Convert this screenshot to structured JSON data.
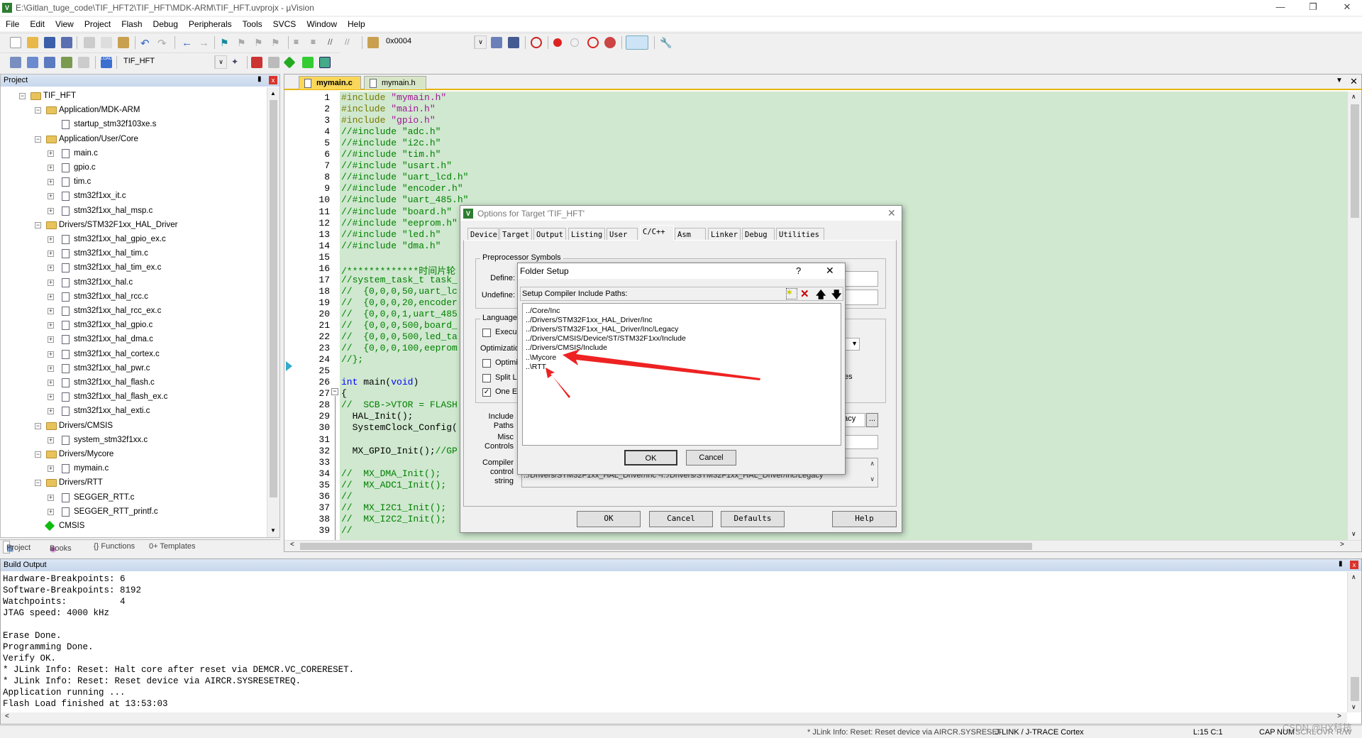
{
  "window": {
    "title": "E:\\Gitlan_tuge_code\\TIF_HFT2\\TIF_HFT\\MDK-ARM\\TIF_HFT.uvprojx - µVision",
    "app_icon": "uvision-icon"
  },
  "menu": [
    "File",
    "Edit",
    "View",
    "Project",
    "Flash",
    "Debug",
    "Peripherals",
    "Tools",
    "SVCS",
    "Window",
    "Help"
  ],
  "toolbar": {
    "address_value": "0x0004",
    "target_value": "TIF_HFT"
  },
  "project_panel": {
    "title": "Project",
    "tree": [
      {
        "label": "TIF_HFT",
        "level": 0,
        "type": "root",
        "expanded": true
      },
      {
        "label": "Application/MDK-ARM",
        "level": 1,
        "type": "folder",
        "expanded": true
      },
      {
        "label": "startup_stm32f103xe.s",
        "level": 2,
        "type": "file",
        "expandable": false
      },
      {
        "label": "Application/User/Core",
        "level": 1,
        "type": "folder",
        "expanded": true
      },
      {
        "label": "main.c",
        "level": 2,
        "type": "file",
        "expandable": true
      },
      {
        "label": "gpio.c",
        "level": 2,
        "type": "file",
        "expandable": true
      },
      {
        "label": "tim.c",
        "level": 2,
        "type": "file",
        "expandable": true
      },
      {
        "label": "stm32f1xx_it.c",
        "level": 2,
        "type": "file",
        "expandable": true
      },
      {
        "label": "stm32f1xx_hal_msp.c",
        "level": 2,
        "type": "file",
        "expandable": true
      },
      {
        "label": "Drivers/STM32F1xx_HAL_Driver",
        "level": 1,
        "type": "folder",
        "expanded": true
      },
      {
        "label": "stm32f1xx_hal_gpio_ex.c",
        "level": 2,
        "type": "file",
        "expandable": true
      },
      {
        "label": "stm32f1xx_hal_tim.c",
        "level": 2,
        "type": "file",
        "expandable": true
      },
      {
        "label": "stm32f1xx_hal_tim_ex.c",
        "level": 2,
        "type": "file",
        "expandable": true
      },
      {
        "label": "stm32f1xx_hal.c",
        "level": 2,
        "type": "file",
        "expandable": true
      },
      {
        "label": "stm32f1xx_hal_rcc.c",
        "level": 2,
        "type": "file",
        "expandable": true
      },
      {
        "label": "stm32f1xx_hal_rcc_ex.c",
        "level": 2,
        "type": "file",
        "expandable": true
      },
      {
        "label": "stm32f1xx_hal_gpio.c",
        "level": 2,
        "type": "file",
        "expandable": true
      },
      {
        "label": "stm32f1xx_hal_dma.c",
        "level": 2,
        "type": "file",
        "expandable": true
      },
      {
        "label": "stm32f1xx_hal_cortex.c",
        "level": 2,
        "type": "file",
        "expandable": true
      },
      {
        "label": "stm32f1xx_hal_pwr.c",
        "level": 2,
        "type": "file",
        "expandable": true
      },
      {
        "label": "stm32f1xx_hal_flash.c",
        "level": 2,
        "type": "file",
        "expandable": true
      },
      {
        "label": "stm32f1xx_hal_flash_ex.c",
        "level": 2,
        "type": "file",
        "expandable": true
      },
      {
        "label": "stm32f1xx_hal_exti.c",
        "level": 2,
        "type": "file",
        "expandable": true
      },
      {
        "label": "Drivers/CMSIS",
        "level": 1,
        "type": "folder",
        "expanded": true
      },
      {
        "label": "system_stm32f1xx.c",
        "level": 2,
        "type": "file",
        "expandable": true
      },
      {
        "label": "Drivers/Mycore",
        "level": 1,
        "type": "folder",
        "expanded": true
      },
      {
        "label": "mymain.c",
        "level": 2,
        "type": "file",
        "expandable": true
      },
      {
        "label": "Drivers/RTT",
        "level": 1,
        "type": "folder",
        "expanded": true
      },
      {
        "label": "SEGGER_RTT.c",
        "level": 2,
        "type": "file",
        "expandable": true
      },
      {
        "label": "SEGGER_RTT_printf.c",
        "level": 2,
        "type": "file",
        "expandable": true
      },
      {
        "label": "CMSIS",
        "level": 1,
        "type": "cmsis",
        "expanded": false
      }
    ],
    "tabs": [
      "Project",
      "Books",
      "{} Functions",
      "0+ Templates"
    ]
  },
  "editor": {
    "tabs": [
      {
        "label": "mymain.c",
        "active": true
      },
      {
        "label": "mymain.h",
        "active": false
      }
    ],
    "lines": [
      [
        [
          "pp",
          "#include "
        ],
        [
          "str",
          "\"mymain.h\""
        ]
      ],
      [
        [
          "pp",
          "#include "
        ],
        [
          "str",
          "\"main.h\""
        ]
      ],
      [
        [
          "pp",
          "#include "
        ],
        [
          "str",
          "\"gpio.h\""
        ]
      ],
      [
        [
          "cm",
          "//#include \"adc.h\""
        ]
      ],
      [
        [
          "cm",
          "//#include \"i2c.h\""
        ]
      ],
      [
        [
          "cm",
          "//#include \"tim.h\""
        ]
      ],
      [
        [
          "cm",
          "//#include \"usart.h\""
        ]
      ],
      [
        [
          "cm",
          "//#include \"uart_lcd.h\""
        ]
      ],
      [
        [
          "cm",
          "//#include \"encoder.h\""
        ]
      ],
      [
        [
          "cm",
          "//#include \"uart_485.h\""
        ]
      ],
      [
        [
          "cm",
          "//#include \"board.h\""
        ]
      ],
      [
        [
          "cm",
          "//#include \"eeprom.h\""
        ]
      ],
      [
        [
          "cm",
          "//#include \"led.h\""
        ]
      ],
      [
        [
          "cm",
          "//#include \"dma.h\""
        ]
      ],
      [],
      [
        [
          "cm",
          "/*************时间片轮"
        ]
      ],
      [
        [
          "cm",
          "//system_task_t task_"
        ]
      ],
      [
        [
          "cm",
          "//  {0,0,0,50,uart_lc"
        ]
      ],
      [
        [
          "cm",
          "//  {0,0,0,20,encoder"
        ]
      ],
      [
        [
          "cm",
          "//  {0,0,0,1,uart_485"
        ]
      ],
      [
        [
          "cm",
          "//  {0,0,0,500,board_"
        ]
      ],
      [
        [
          "cm",
          "//  {0,0,0,500,led_ta"
        ]
      ],
      [
        [
          "cm",
          "//  {0,0,0,100,eeprom"
        ]
      ],
      [
        [
          "cm",
          "//};"
        ]
      ],
      [],
      [
        [
          "kw",
          "int"
        ],
        [
          "nm",
          " main("
        ],
        [
          "kw",
          "void"
        ],
        [
          "nm",
          ")"
        ]
      ],
      [
        [
          "nm",
          "{"
        ]
      ],
      [
        [
          "cm",
          "//  SCB->VTOR = FLASH"
        ]
      ],
      [
        [
          "nm",
          "  HAL_Init();"
        ]
      ],
      [
        [
          "nm",
          "  SystemClock_Config("
        ]
      ],
      [],
      [
        [
          "nm",
          "  MX_GPIO_Init();"
        ],
        [
          "cm",
          "//GP"
        ]
      ],
      [],
      [
        [
          "cm",
          "//  MX_DMA_Init();"
        ]
      ],
      [
        [
          "cm",
          "//  MX_ADC1_Init();"
        ]
      ],
      [
        [
          "cm",
          "//"
        ]
      ],
      [
        [
          "cm",
          "//  MX_I2C1_Init();"
        ]
      ],
      [
        [
          "cm",
          "//  MX_I2C2_Init();"
        ]
      ],
      [
        [
          "cm",
          "//"
        ]
      ]
    ]
  },
  "build_output": {
    "title": "Build Output",
    "lines": [
      "Hardware-Breakpoints: 6",
      "Software-Breakpoints: 8192",
      "Watchpoints:          4",
      "JTAG speed: 4000 kHz",
      "",
      "Erase Done.",
      "Programming Done.",
      "Verify OK.",
      "* JLink Info: Reset: Halt core after reset via DEMCR.VC_CORERESET.",
      "* JLink Info: Reset: Reset device via AIRCR.SYSRESETREQ.",
      "Application running ...",
      "Flash Load finished at 13:53:03"
    ]
  },
  "status_bar": {
    "message": "* JLink Info: Reset: Reset device via AIRCR.SYSRESET",
    "debugger": "J-LINK / J-TRACE Cortex",
    "cursor": "L:15 C:1",
    "indicators": [
      "CAP",
      "NUM",
      "SCRL",
      "OVR",
      "R/W"
    ],
    "watermark": "CSDN @HX科技"
  },
  "options_dialog": {
    "title": "Options for Target 'TIF_HFT'",
    "tabs": [
      "Device",
      "Target",
      "Output",
      "Listing",
      "User",
      "C/C++",
      "Asm",
      "Linker",
      "Debug",
      "Utilities"
    ],
    "active_tab": "C/C++",
    "preprocessor_group": "Preprocessor Symbols",
    "define_label": "Define:",
    "undefine_label": "Undefine:",
    "language_group": "Language",
    "execute_only": {
      "label": "Execu",
      "checked": false
    },
    "optimization_label": "Optimizatio",
    "optimize_time": {
      "label": "Optimi",
      "checked": false
    },
    "split_ldm": {
      "label": "Split L",
      "checked": false
    },
    "one_elf": {
      "label": "One E",
      "checked": true
    },
    "partial_right_label": "es",
    "include_paths_label": "Include Paths",
    "include_paths_value": "gacy",
    "browse_label": "...",
    "misc_label": "Misc Controls",
    "compiler_string_label": "Compiler control string",
    "compiler_string_value": "../Drivers/STM32F1xx_HAL_Driver/Inc -I../Drivers/STM32F1xx_HAL_Driver/Inc/Legacy",
    "buttons": {
      "ok": "OK",
      "cancel": "Cancel",
      "defaults": "Defaults",
      "help": "Help"
    }
  },
  "folder_setup": {
    "title": "Folder Setup",
    "help": "?",
    "label": "Setup Compiler Include Paths:",
    "paths": [
      "../Core/Inc",
      "../Drivers/STM32F1xx_HAL_Driver/Inc",
      "../Drivers/STM32F1xx_HAL_Driver/Inc/Legacy",
      "../Drivers/CMSIS/Device/ST/STM32F1xx/Include",
      "../Drivers/CMSIS/Include",
      "..\\Mycore",
      "..\\RTT"
    ],
    "ok": "OK",
    "cancel": "Cancel",
    "annotation_color": "#ee2222"
  }
}
